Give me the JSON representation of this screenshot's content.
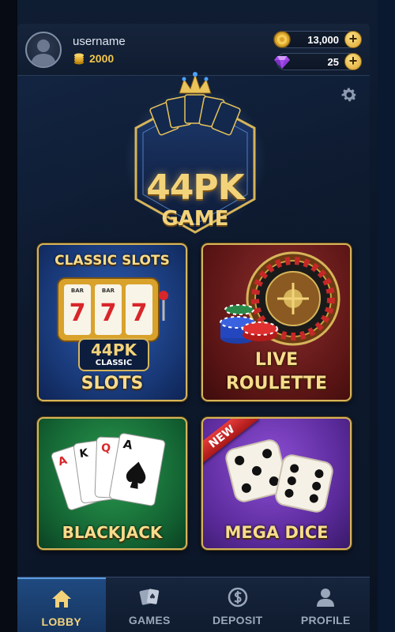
{
  "header": {
    "username": "username",
    "coins": "2000",
    "gold_balance": "13,000",
    "gem_balance": "25",
    "plus_symbol": "+"
  },
  "logo": {
    "line1": "44PK",
    "line2": "GAME"
  },
  "games": [
    {
      "title_top": "CLASSIC SLOTS",
      "badge_line1": "44PK",
      "badge_line2": "CLASSIC",
      "label": "SLOTS",
      "reel_symbol": "7",
      "reel_text": "BAR"
    },
    {
      "label_line1": "LIVE",
      "label_line2": "ROULETTE"
    },
    {
      "label": "BLACKJACK",
      "cards": [
        "A",
        "K",
        "Q",
        "A"
      ]
    },
    {
      "ribbon": "NEW",
      "label": "MEGA DICE"
    }
  ],
  "nav": {
    "items": [
      {
        "label": "LOBBY",
        "icon": "home-icon",
        "active": true
      },
      {
        "label": "GAMES",
        "icon": "cards-icon",
        "active": false
      },
      {
        "label": "DEPOSIT",
        "icon": "dollar-icon",
        "active": false
      },
      {
        "label": "PROFILE",
        "icon": "person-icon",
        "active": false
      }
    ]
  },
  "colors": {
    "gold": "#f3d37a",
    "active_nav": "#1f4a80",
    "background": "#0b1422"
  }
}
